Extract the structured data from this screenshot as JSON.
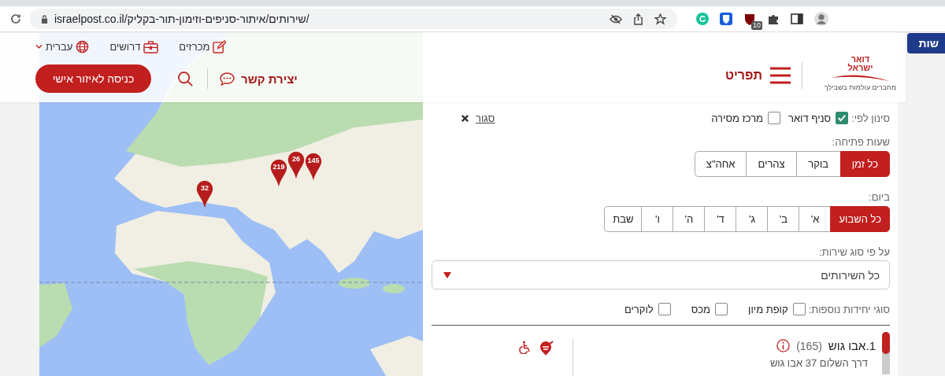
{
  "browser": {
    "url": "israelpost.co.il/שירותים/איתור-סניפים-וזימון-תור-בקליק/",
    "extension_badge": "10"
  },
  "header": {
    "links": [
      {
        "label": "מכרזים",
        "kind": "tenders"
      },
      {
        "label": "דרושים",
        "kind": "jobs"
      },
      {
        "label": "עברית",
        "kind": "language"
      }
    ],
    "login_button": "כניסה לאיזור אישי",
    "contact": "יצירת קשר",
    "menu": "תפריט",
    "logo": {
      "title_lines": [
        "דואר",
        "ישראל"
      ],
      "tagline": "מחברים עולמות בשבילך"
    }
  },
  "side_button": "שות",
  "map": {
    "markers": [
      {
        "count": "32"
      },
      {
        "count": "219"
      },
      {
        "count": "26"
      },
      {
        "count": "145"
      }
    ]
  },
  "filters": {
    "filter_by_label": "סינון לפי:",
    "types": [
      {
        "label": "סניף דואר",
        "checked": true
      },
      {
        "label": "מרכז מסירה",
        "checked": false
      }
    ],
    "close": "סגור",
    "hours_label": "שעות פתיחה:",
    "hours": [
      {
        "label": "כל זמן",
        "selected": true
      },
      {
        "label": "בוקר",
        "selected": false
      },
      {
        "label": "צהרים",
        "selected": false
      },
      {
        "label": "אחה\"צ",
        "selected": false
      }
    ],
    "day_label": "ביום:",
    "days": [
      {
        "label": "כל השבוע",
        "selected": true
      },
      {
        "label": "א'",
        "selected": false
      },
      {
        "label": "ב'",
        "selected": false
      },
      {
        "label": "ג'",
        "selected": false
      },
      {
        "label": "ד'",
        "selected": false
      },
      {
        "label": "ה'",
        "selected": false
      },
      {
        "label": "ו'",
        "selected": false
      },
      {
        "label": "שבת",
        "selected": false
      }
    ],
    "service_label": "על פי סוג שירות:",
    "service_value": "כל השירותים",
    "extra_label": "סוגי יחידות נוספות:",
    "extras": [
      {
        "label": "קופת מיון",
        "checked": false
      },
      {
        "label": "מכס",
        "checked": false
      },
      {
        "label": "לוקרים",
        "checked": false
      }
    ]
  },
  "results": [
    {
      "name": "1.אבו גוש",
      "count": "(165)",
      "address": "דרך השלום 37 אבו גוש"
    }
  ]
}
